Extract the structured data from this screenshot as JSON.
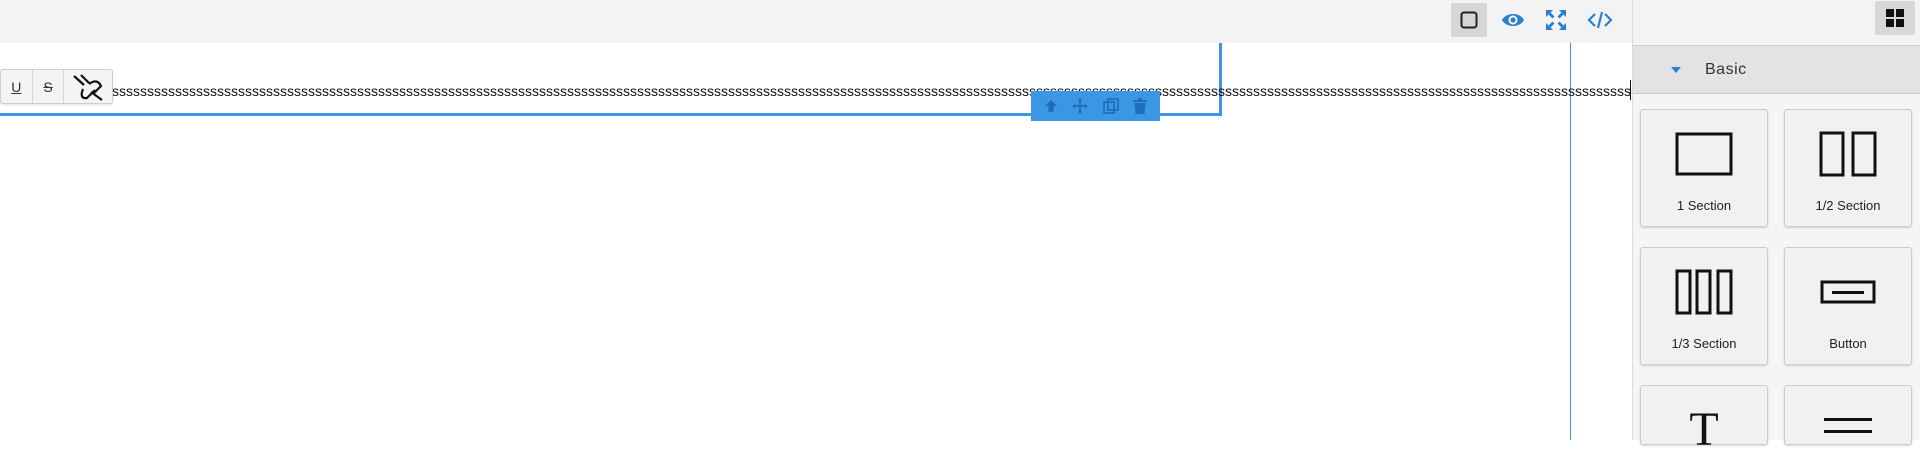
{
  "toolbar": {
    "buttons": [
      {
        "name": "square-icon",
        "active": true
      },
      {
        "name": "eye-icon"
      },
      {
        "name": "fullscreen-icon"
      },
      {
        "name": "code-icon"
      }
    ],
    "accent": "#3b97e3",
    "icon_color": "#2b7fd0"
  },
  "panel": {
    "toggle_icon": "blocks-grid-icon",
    "category": {
      "title": "Basic",
      "icon": "caret-down-icon"
    },
    "blocks": [
      {
        "label": "1 Section",
        "icon": "one-section-icon"
      },
      {
        "label": "1/2 Section",
        "icon": "two-section-icon"
      },
      {
        "label": "1/3 Section",
        "icon": "three-section-icon"
      },
      {
        "label": "Button",
        "icon": "button-icon"
      },
      {
        "label": "",
        "icon": "text-icon"
      },
      {
        "label": "",
        "icon": "divider-icon"
      }
    ]
  },
  "editor": {
    "text": "sssssssssssssssssssssssssssssssssssssssssssssssssssssssssssssssssssssssssssssssssssssssssssssssssssssssssssssssssssssssssssssssssssssssssssssssssssssssssssssssssssssssssssssssssssssssssssssssssssssssssssssssssssssssssssssssssssssssssssssssssssssssssssssssssssssssssssssssssss",
    "rte": {
      "underline": "U",
      "strike": "S",
      "link_icon": "unlink-icon"
    },
    "badge": [
      "arrow-up-icon",
      "move-icon",
      "clone-icon",
      "delete-icon"
    ]
  }
}
